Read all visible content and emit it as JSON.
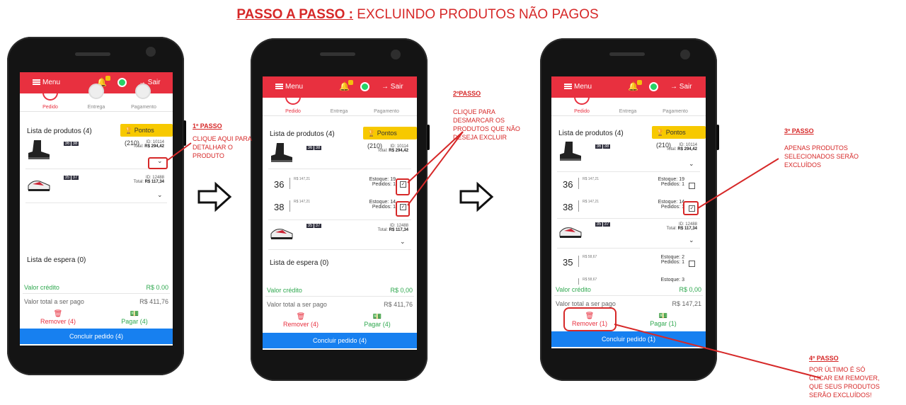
{
  "title": {
    "bold_part": "PASSO A PASSO :",
    "rest": "EXCLUINDO PRODUTOS NÃO PAGOS"
  },
  "colors": {
    "brand_red": "#e8303f",
    "annotation_red": "#d62828",
    "accent_yellow": "#f7c900",
    "action_blue": "#1780f0",
    "positive_green": "#2fa84f"
  },
  "topbar": {
    "menu_label": "Menu",
    "logout_label": "Sair",
    "icons": [
      "hamburger-icon",
      "bell-icon",
      "whatsapp-icon",
      "logout-icon"
    ]
  },
  "steps": {
    "pedido": "Pedido",
    "entrega": "Entrega",
    "pagamento": "Pagamento"
  },
  "products_header": "Lista de produtos (4)",
  "pontos": "Pontos (210)",
  "waitlist": "Lista de espera (0)",
  "credito_label": "Valor crédito",
  "credito_value": "R$ 0,00",
  "credito_value_1": "R$ 0.00",
  "total_label": "Valor total a ser pago",
  "product1": {
    "sizes": [
      "36",
      "38"
    ],
    "id": "ID: 10114",
    "total_label": "Total:",
    "total": "R$ 294,42"
  },
  "product2": {
    "sizes": [
      "35",
      "37"
    ],
    "id": "ID: 12488",
    "total_label": "Total:",
    "total": "R$ 117,34"
  },
  "size_rows": {
    "r36": {
      "size": "36",
      "price": "R$ 147,21",
      "estoque_label": "Estoque:",
      "estoque": "19",
      "pedidos_label": "Pedidos:",
      "pedidos": "1"
    },
    "r38": {
      "size": "38",
      "price": "R$ 147,21",
      "estoque_label": "Estoque:",
      "estoque": "14",
      "pedidos_label": "Pedidos:",
      "pedidos": "1"
    },
    "r35": {
      "size": "35",
      "price": "R$ 58,67",
      "estoque_label": "Estoque:",
      "estoque": "2",
      "pedidos_label": "Pedidos:",
      "pedidos": "1"
    },
    "r37": {
      "price": "R$ 58,67",
      "estoque_label": "Estoque:",
      "estoque": "3"
    }
  },
  "phone1": {
    "total_value": "R$ 411,76",
    "remover": "Remover (4)",
    "pagar": "Pagar (4)",
    "concluir": "Concluir pedido (4)"
  },
  "phone2": {
    "total_value": "R$ 411,76",
    "remover": "Remover (4)",
    "pagar": "Pagar (4)",
    "concluir": "Concluir pedido (4)"
  },
  "phone3": {
    "total_value": "R$ 147,21",
    "remover": "Remover (1)",
    "pagar": "Pagar (1)",
    "concluir": "Concluir pedido (1)"
  },
  "notes": {
    "step1": {
      "heading": "1º PASSO",
      "text": "CLIQUE AQUI PARA DETALHAR O PRODUTO"
    },
    "step2": {
      "heading": "2ºPASSO",
      "text": "CLIQUE PARA DESMARCAR OS PRODUTOS QUE NÃO DESEJA EXCLUIR"
    },
    "step3": {
      "heading": "3º PASSO",
      "text": "APENAS PRODUTOS SELECIONADOS SERÃO EXCLUÍDOS"
    },
    "step4": {
      "heading": "4º PASSO",
      "text": "POR ÚLTIMO É SÓ CLICAR EM REMOVER, QUE SEUS PRODUTOS SERÃO EXCLUÍDOS!"
    }
  }
}
